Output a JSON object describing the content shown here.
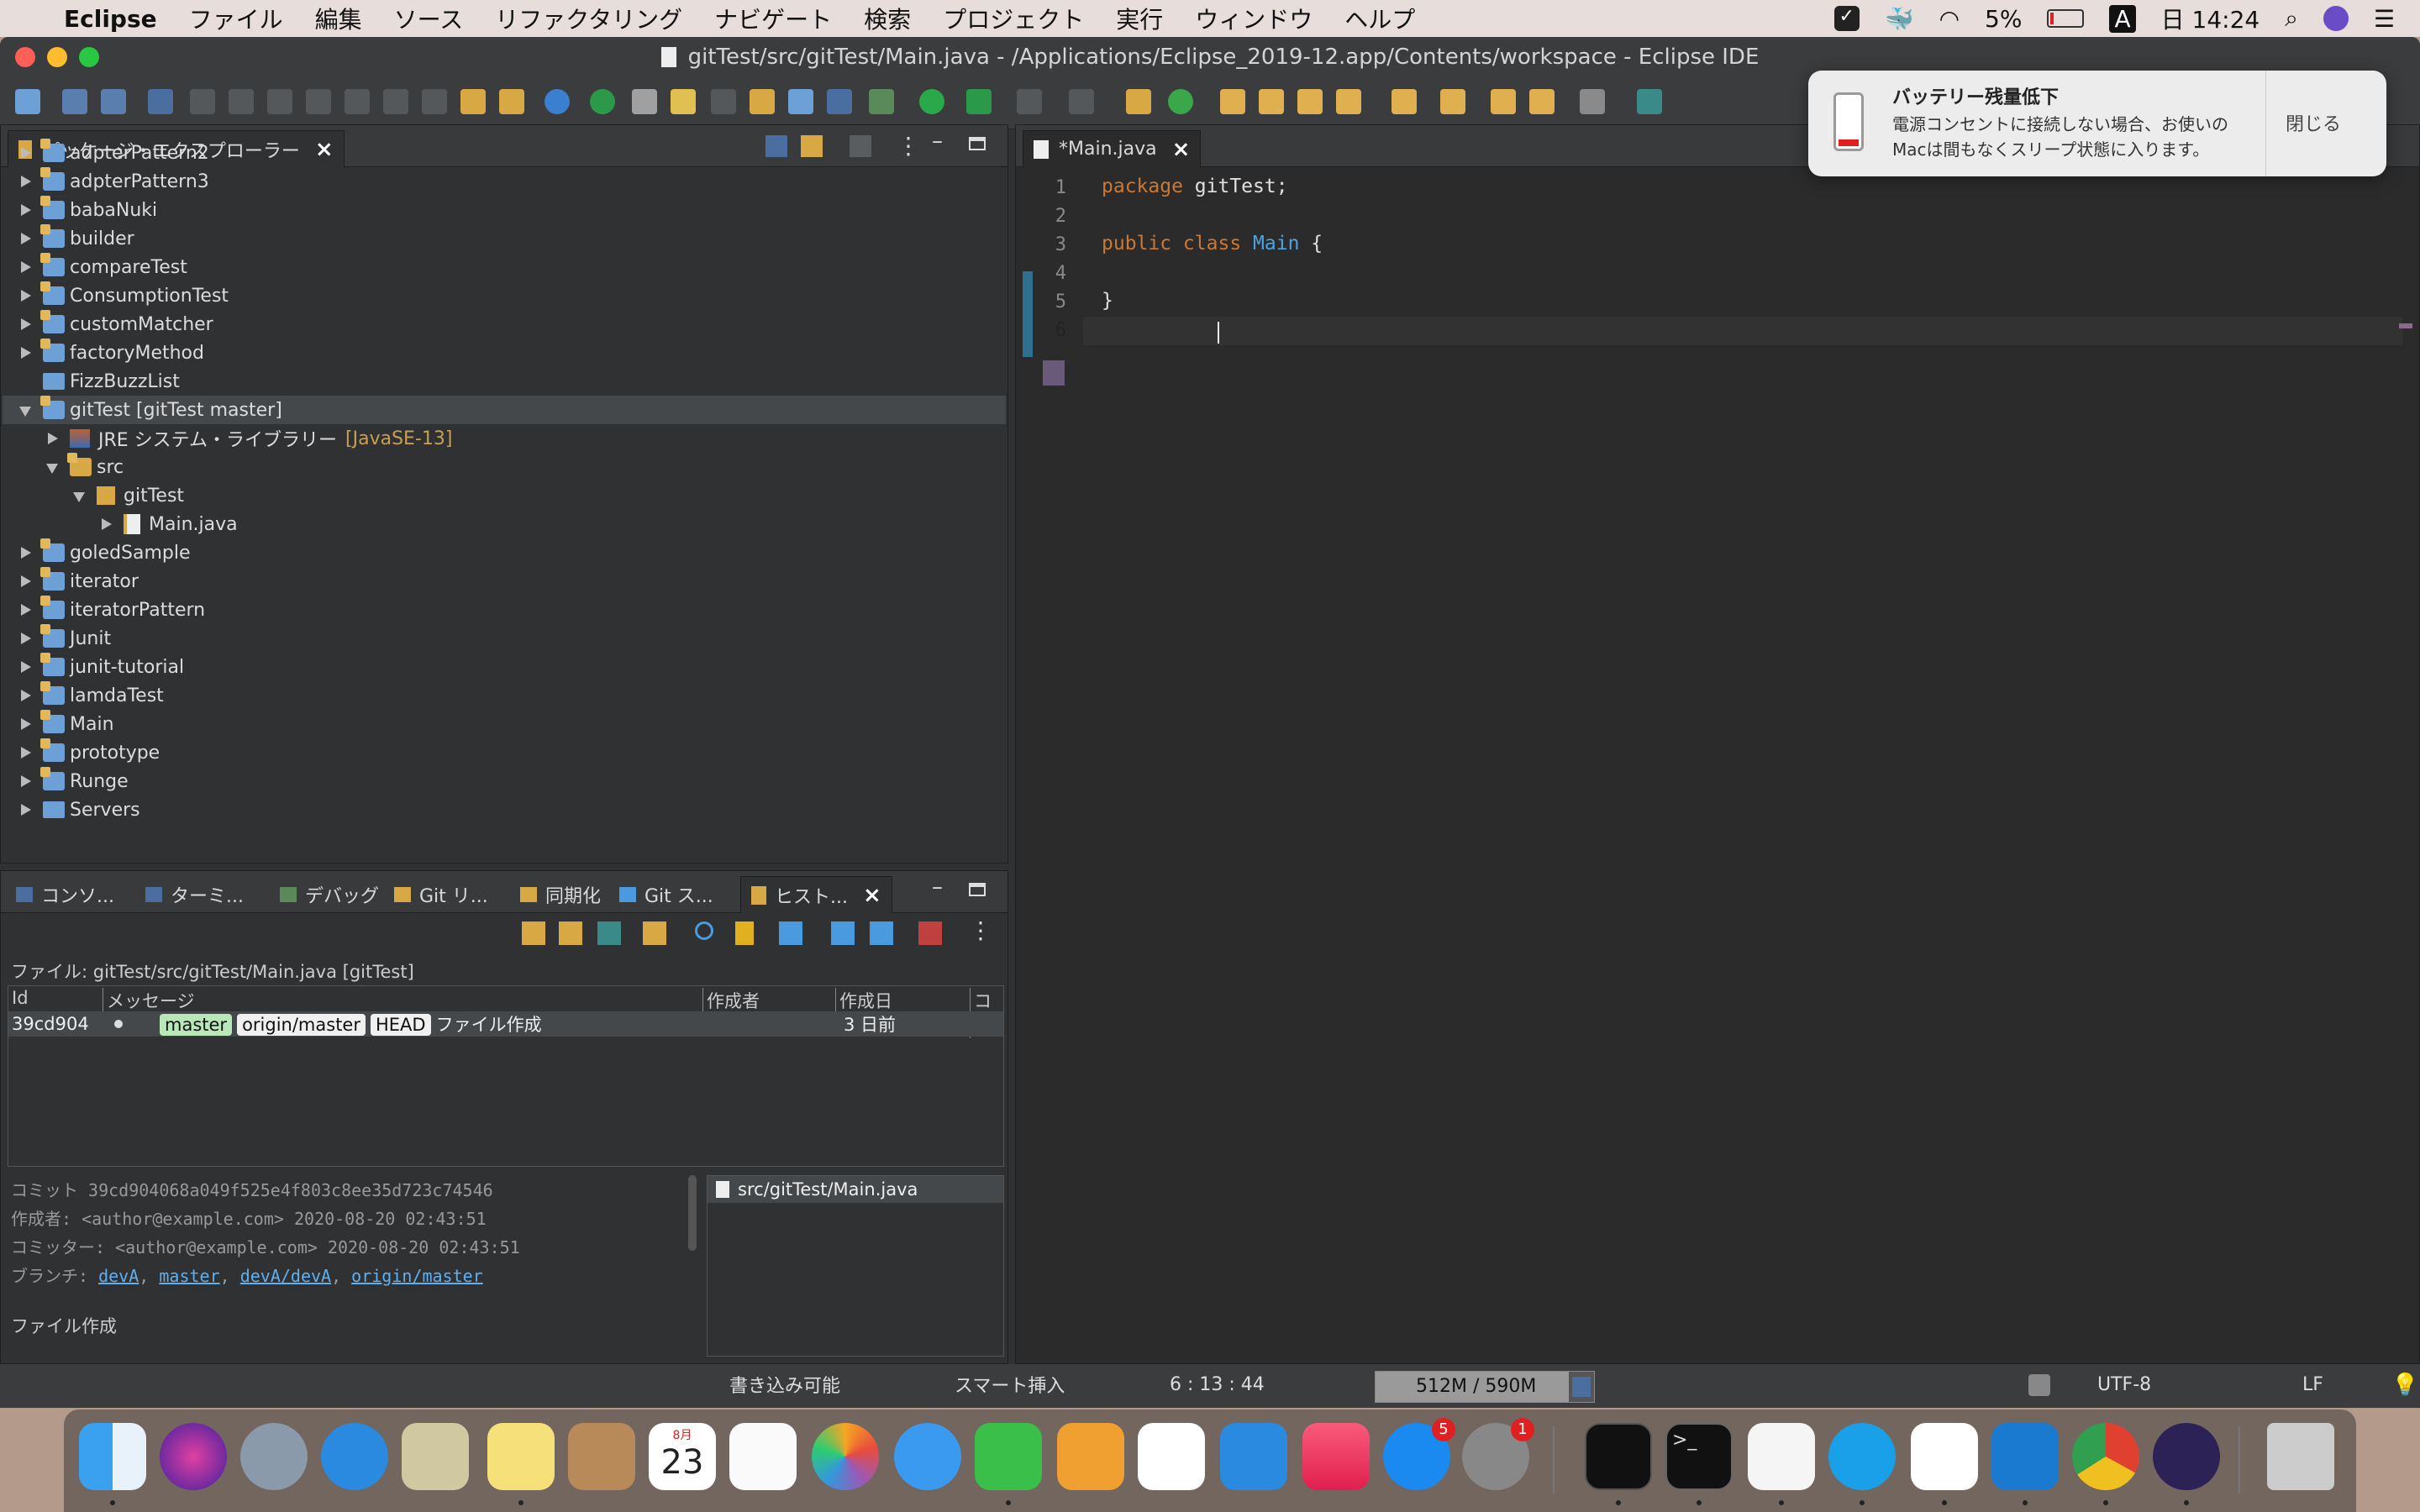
{
  "menubar": {
    "app": "Eclipse",
    "items": [
      "ファイル",
      "編集",
      "ソース",
      "リファクタリング",
      "ナビゲート",
      "検索",
      "プロジェクト",
      "実行",
      "ウィンドウ",
      "ヘルプ"
    ],
    "battery": "5%",
    "input": "A",
    "clock": "日 14:24"
  },
  "window": {
    "title": "gitTest/src/gitTest/Main.java - /Applications/Eclipse_2019-12.app/Contents/workspace - Eclipse IDE"
  },
  "explorer": {
    "title": "パッケージ・エクスプローラー",
    "items": [
      {
        "label": "adpterPattern2"
      },
      {
        "label": "adpterPattern3"
      },
      {
        "label": "babaNuki"
      },
      {
        "label": "builder"
      },
      {
        "label": "compareTest"
      },
      {
        "label": "ConsumptionTest"
      },
      {
        "label": "customMatcher"
      },
      {
        "label": "factoryMethod"
      },
      {
        "label": "FizzBuzzList"
      },
      {
        "label": "gitTest [gitTest master]"
      },
      {
        "label": "JRE システム・ライブラリー"
      },
      {
        "label": "src"
      },
      {
        "label": "gitTest"
      },
      {
        "label": "Main.java"
      },
      {
        "label": "goledSample"
      },
      {
        "label": "iterator"
      },
      {
        "label": "iteratorPattern"
      },
      {
        "label": "Junit"
      },
      {
        "label": "junit-tutorial"
      },
      {
        "label": "lamdaTest"
      },
      {
        "label": "Main"
      },
      {
        "label": "prototype"
      },
      {
        "label": "Runge"
      },
      {
        "label": "Servers"
      }
    ],
    "jre_suffix": "[JavaSE-13]"
  },
  "editor": {
    "tab": "*Main.java",
    "lines": [
      "package gitTest;",
      "",
      "public class Main {",
      "",
      "}",
      ""
    ],
    "line_numbers": [
      "1",
      "2",
      "3",
      "4",
      "5",
      "6"
    ]
  },
  "bottom": {
    "tabs": [
      "コンソ...",
      "ターミ...",
      "デバッグ",
      "Git リ...",
      "同期化",
      "Git ス...",
      "ヒスト..."
    ],
    "file_label": "ファイル: gitTest/src/gitTest/Main.java [gitTest]",
    "columns": [
      "Id",
      "メッセージ",
      "作成者",
      "作成日",
      "コミ"
    ],
    "row": {
      "id": "39cd904",
      "badges": [
        "master",
        "origin/master",
        "HEAD"
      ],
      "message": "ファイル作成",
      "date": "3 日前"
    },
    "commit": "コミット 39cd904068a049f525e4f803c8ee35d723c74546",
    "author": "作成者:  <author@example.com> 2020-08-20 02:43:51",
    "committer": "コミッター:  <author@example.com> 2020-08-20 02:43:51",
    "branch_label": "ブランチ:",
    "branches": [
      "devA",
      "master",
      "devA/devA",
      "origin/master"
    ],
    "commit_message": "ファイル作成",
    "changed_file": "src/gitTest/Main.java"
  },
  "status": {
    "writable": "書き込み可能",
    "insert": "スマート挿入",
    "position": "6 : 13 : 44",
    "heap": "512M / 590M",
    "encoding": "UTF-8",
    "eol": "LF"
  },
  "notification": {
    "title": "バッテリー残量低下",
    "body1": "電源コンセントに接続しない場合、お使いの",
    "body2": "Macは間もなくスリープ状態に入ります。",
    "button": "閉じる"
  },
  "dock": {
    "calendar_month": "8月",
    "calendar_day": "23",
    "appstore_badge": "5",
    "settings_badge": "1"
  }
}
